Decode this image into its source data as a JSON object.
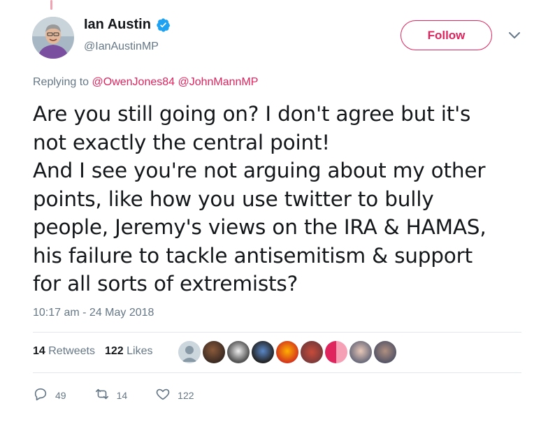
{
  "author": {
    "name": "Ian Austin",
    "handle": "@IanAustinMP",
    "verified": true
  },
  "follow_button": {
    "label": "Follow"
  },
  "reply": {
    "prefix": "Replying to",
    "mentions": [
      "@OwenJones84",
      "@JohnMannMP"
    ]
  },
  "tweet": {
    "lines": [
      "Are you still going on? I don't agree but it's",
      "not exactly the central point!",
      "And I see you're not arguing about my other",
      "points, like how you use twitter to bully",
      "people, Jeremy's views on the IRA & HAMAS,",
      "his failure to tackle antisemitism & support",
      "for all sorts of extremists?"
    ],
    "timestamp": "10:17 am - 24 May 2018"
  },
  "stats": {
    "retweets_count": "14",
    "retweets_label": "Retweets",
    "likes_count": "122",
    "likes_label": "Likes"
  },
  "actions": {
    "replies": "49",
    "retweets": "14",
    "likes": "122"
  },
  "colors": {
    "accent": "#e0245e",
    "verified": "#1da1f2",
    "secondary_text": "#657786"
  },
  "icons": [
    "verified-badge-icon",
    "chevron-down-icon",
    "reply-icon",
    "retweet-icon",
    "heart-icon"
  ]
}
